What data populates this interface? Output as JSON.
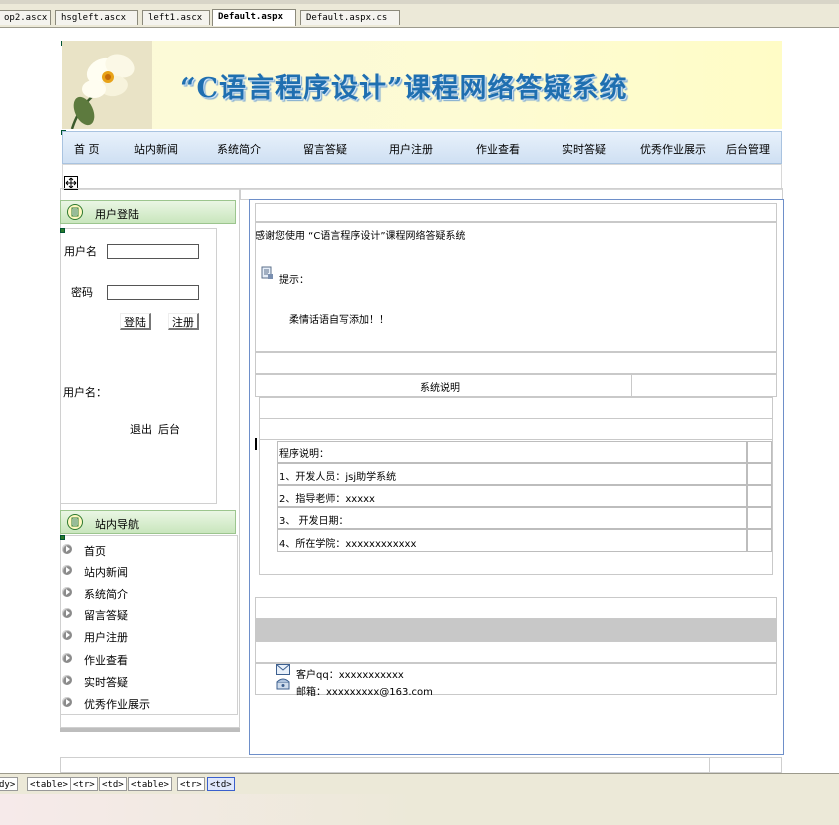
{
  "tabs": [
    "op2.ascx",
    "hsgleft.ascx",
    "left1.ascx",
    "Default.aspx",
    "Default.aspx.cs"
  ],
  "active_tab": "Default.aspx",
  "header": {
    "title": "“C语言程序设计”课程网络答疑系统",
    "nav": [
      "首 页",
      "站内新闻",
      "系统简介",
      "留言答疑",
      "用户注册",
      "作业查看",
      "实时答疑",
      "优秀作业展示",
      "后台管理"
    ]
  },
  "login": {
    "panel_title": "用户登陆",
    "username_label": "用户名",
    "password_label": "密码",
    "username_value": "",
    "password_value": "",
    "login_button": "登陆",
    "register_button": "注册",
    "user_label": "用户名：",
    "logout_link": "退出",
    "admin_link": "后台"
  },
  "site_nav": {
    "panel_title": "站内导航",
    "items": [
      "首页",
      "站内新闻",
      "系统简介",
      "留言答疑",
      "用户注册",
      "作业查看",
      "实时答疑",
      "优秀作业展示"
    ]
  },
  "main": {
    "welcome": "感谢您使用 “C语言程序设计”课程网络答疑系统",
    "tip_label": "提示：",
    "tip_text": "柔情话语自写添加！！",
    "section_title": "系统说明",
    "program_title": "程序说明：",
    "lines": [
      "1、开发人员：jsj助学系统",
      "2、指导老师：xxxxx",
      "3、 开发日期：",
      "4、所在学院：xxxxxxxxxxxx"
    ],
    "contact_qq": "客户qq：xxxxxxxxxxx",
    "contact_email": "邮箱：xxxxxxxxx@163.com"
  },
  "tag_path": [
    "dy>",
    "<table>",
    "<tr>",
    "<td>",
    "<table>",
    "<tr>",
    "<td>"
  ],
  "colors": {
    "title_blue": "#1f6fb0",
    "nav_bg": "#dbe8f6",
    "panel_green": "#c9e6bd",
    "main_border": "#6e8fc9",
    "footer_gray": "#c8c8c8"
  }
}
